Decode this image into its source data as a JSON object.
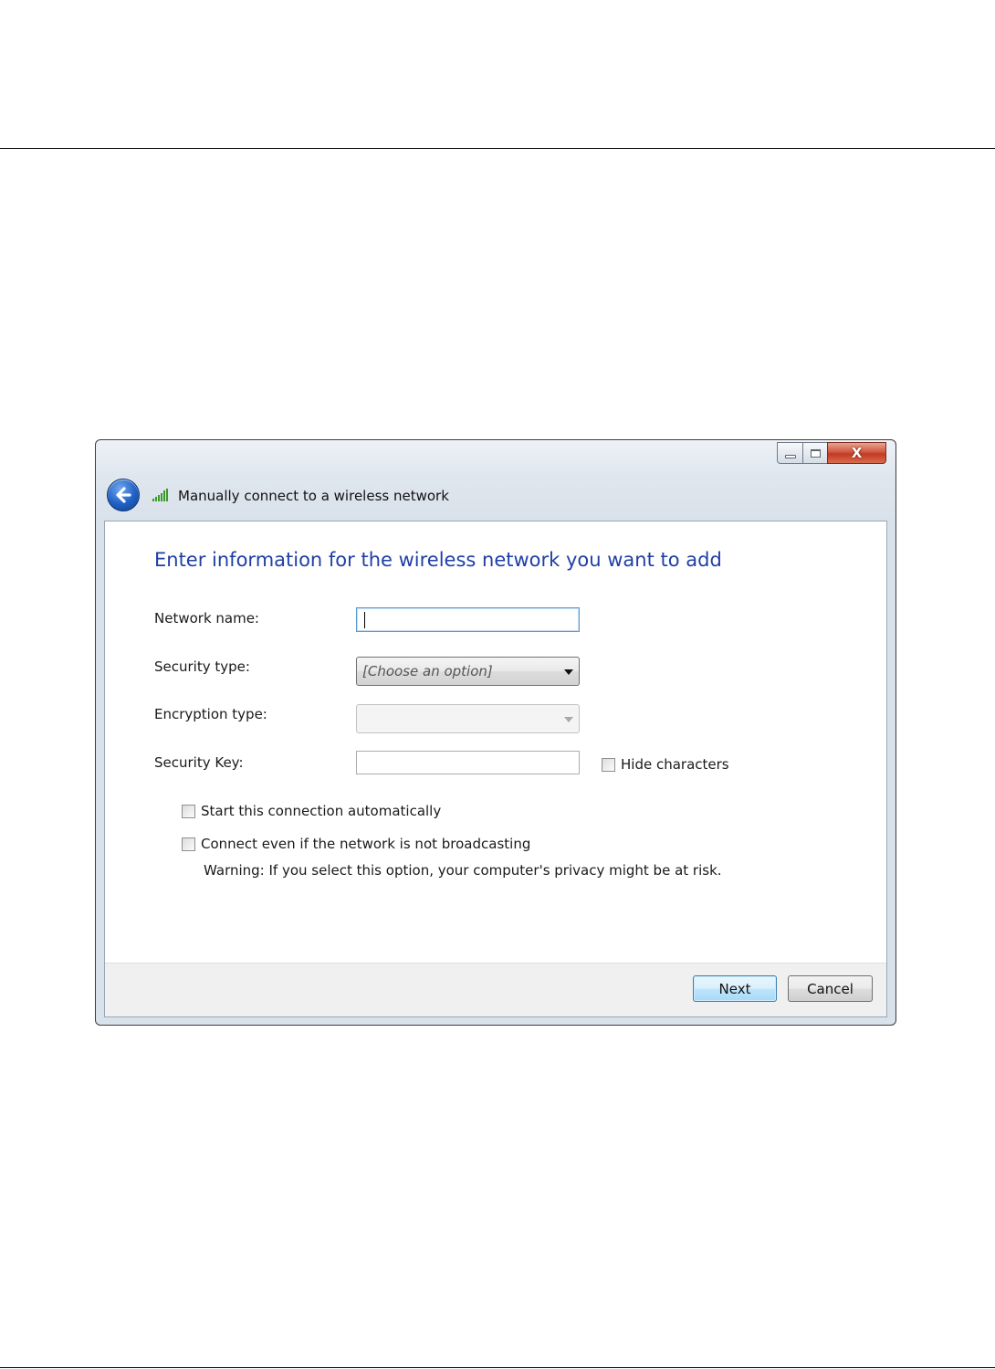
{
  "window": {
    "title": "Manually connect to a wireless network",
    "caption_buttons": {
      "minimize_icon": "minimize-icon",
      "maximize_icon": "maximize-icon",
      "close_glyph": "X"
    }
  },
  "form": {
    "heading": "Enter information for the wireless network you want to add",
    "network_name": {
      "label": "Network name:",
      "value": ""
    },
    "security_type": {
      "label": "Security type:",
      "selected": "[Choose an option]"
    },
    "encryption_type": {
      "label": "Encryption type:",
      "selected": ""
    },
    "security_key": {
      "label": "Security Key:",
      "value": ""
    },
    "hide_characters": {
      "label": "Hide characters",
      "checked": false
    },
    "start_automatically": {
      "label": "Start this connection automatically",
      "checked": false
    },
    "connect_not_broadcasting": {
      "label": "Connect even if the network is not broadcasting",
      "checked": false
    },
    "warning": "Warning: If you select this option, your computer's privacy might be at risk."
  },
  "footer": {
    "next_label": "Next",
    "cancel_label": "Cancel"
  },
  "colors": {
    "heading": "#1f3fa6",
    "accent": "#3c7fb1",
    "close_button": "#c43a22"
  }
}
